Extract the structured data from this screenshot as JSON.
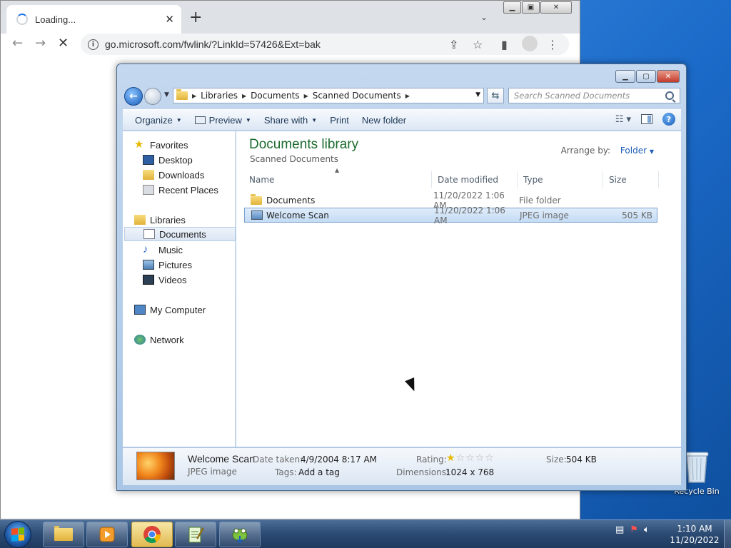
{
  "desktop": {
    "recycle_bin": "Recycle Bin"
  },
  "chrome": {
    "tab_title": "Loading...",
    "url": "go.microsoft.com/fwlink/?LinkId=57426&Ext=bak"
  },
  "explorer": {
    "breadcrumbs": [
      "Libraries",
      "Documents",
      "Scanned Documents"
    ],
    "search_placeholder": "Search Scanned Documents",
    "commands": {
      "organize": "Organize",
      "preview": "Preview",
      "share_with": "Share with",
      "print": "Print",
      "new_folder": "New folder"
    },
    "nav": {
      "favorites": "Favorites",
      "desktop": "Desktop",
      "downloads": "Downloads",
      "recent_places": "Recent Places",
      "libraries": "Libraries",
      "documents": "Documents",
      "music": "Music",
      "pictures": "Pictures",
      "videos": "Videos",
      "my_computer": "My Computer",
      "network": "Network"
    },
    "library_title": "Documents library",
    "library_subtitle": "Scanned Documents",
    "arrange_by_label": "Arrange by:",
    "arrange_by_value": "Folder",
    "columns": {
      "name": "Name",
      "date_modified": "Date modified",
      "type": "Type",
      "size": "Size"
    },
    "files": [
      {
        "name": "Documents",
        "date": "11/20/2022 1:06 AM",
        "type": "File folder",
        "size": ""
      },
      {
        "name": "Welcome Scan",
        "date": "11/20/2022 1:06 AM",
        "type": "JPEG image",
        "size": "505 KB"
      }
    ],
    "details": {
      "name": "Welcome Scan",
      "kind": "JPEG image",
      "date_taken_label": "Date taken:",
      "date_taken": "4/9/2004 8:17 AM",
      "tags_label": "Tags:",
      "tags": "Add a tag",
      "rating_label": "Rating:",
      "rating": 1,
      "rating_max": 5,
      "dimensions_label": "Dimensions:",
      "dimensions": "1024 x 768",
      "size_label": "Size:",
      "size": "504 KB"
    }
  },
  "taskbar": {
    "time": "1:10 AM",
    "date": "11/20/2022"
  }
}
